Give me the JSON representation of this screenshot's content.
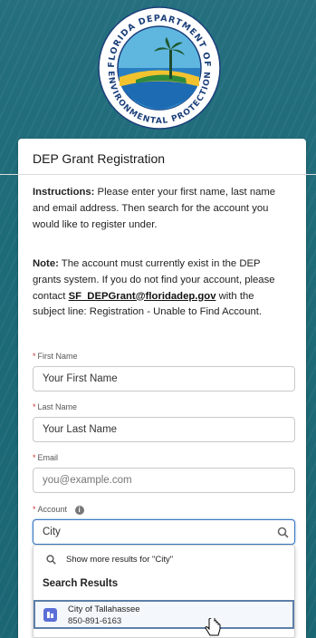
{
  "seal": {
    "text": "FLORIDA DEPARTMENT OF ENVIRONMENTAL PROTECTION"
  },
  "form": {
    "title": "DEP Grant Registration",
    "instructions_label": "Instructions:",
    "instructions_text": " Please enter your first name, last name and email address. Then search for the account you would like to register under.",
    "note_label": "Note:",
    "note_text_1": " The account must currently exist in the DEP grants system. If you do not find your account, please contact ",
    "note_email": "SF_DEPGrant@floridadep.gov",
    "note_text_2": " with the subject line: Registration - Unable to Find Account.",
    "first_name": {
      "label": "First Name",
      "value": "Your First Name"
    },
    "last_name": {
      "label": "Last Name",
      "value": "Your Last Name"
    },
    "email": {
      "label": "Email",
      "placeholder": "you@example.com"
    },
    "account": {
      "label": "Account",
      "value": "City",
      "info_icon": "info-icon"
    }
  },
  "dropdown": {
    "show_more": "Show more results for \"City\"",
    "section_title": "Search Results",
    "results": [
      {
        "name": "City of Tallahassee",
        "phone": "850-891-6163"
      }
    ]
  }
}
